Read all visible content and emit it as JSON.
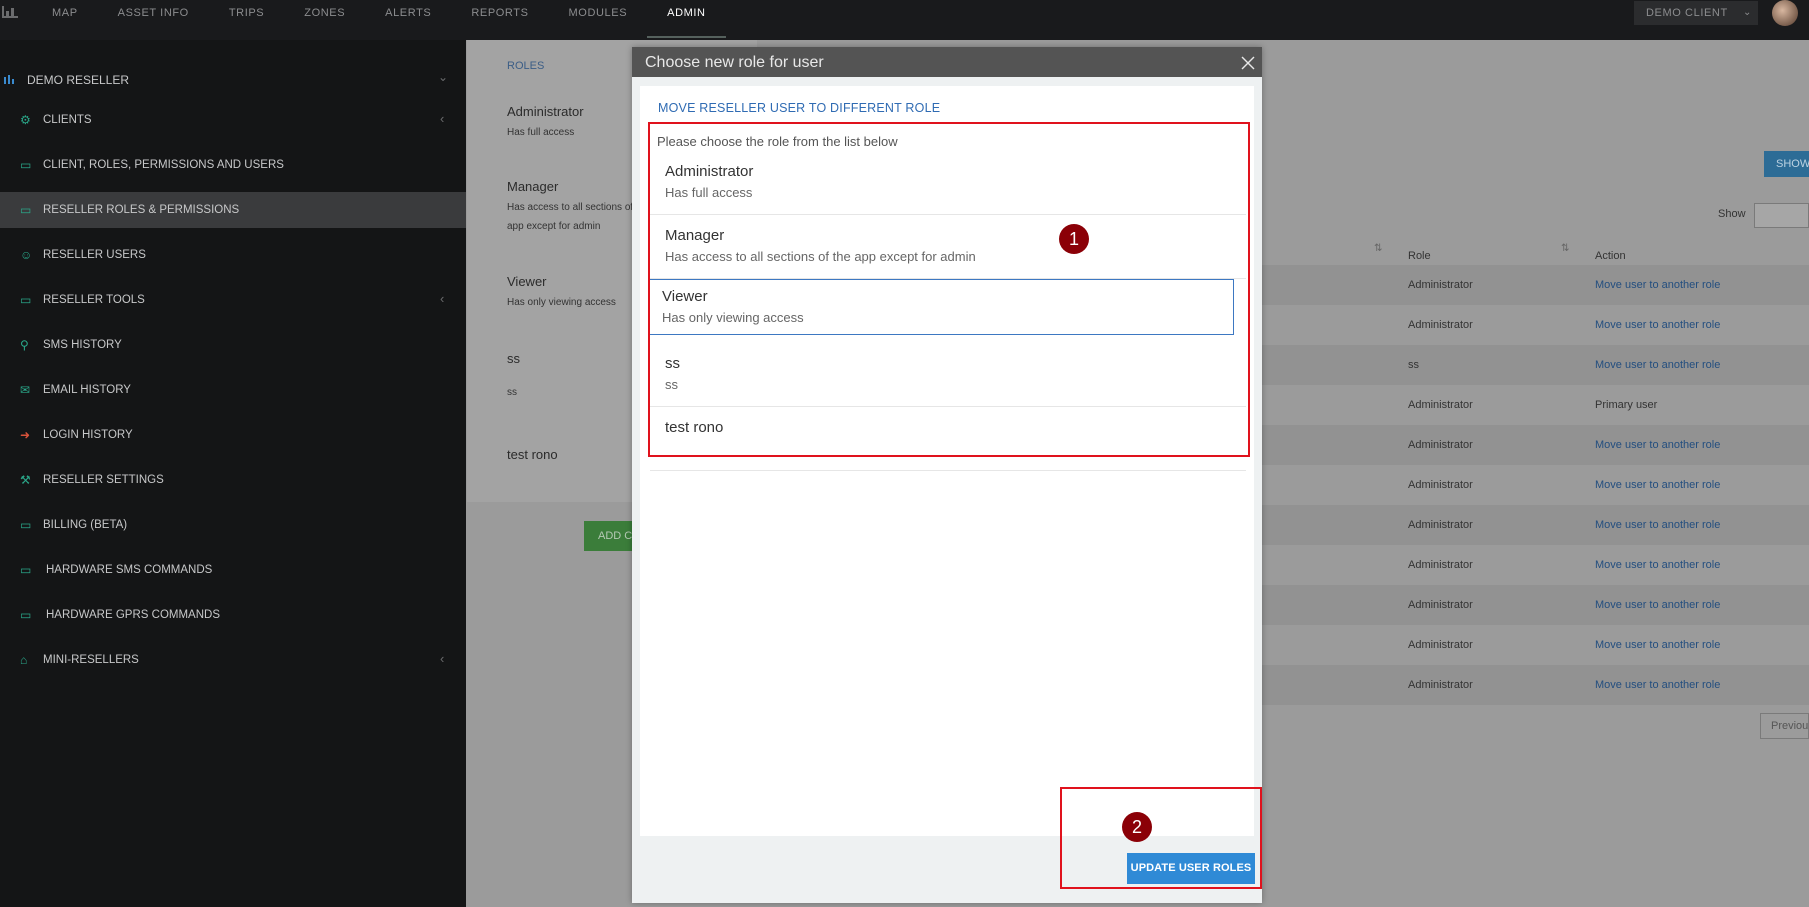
{
  "topbar": {
    "nav": [
      "MAP",
      "ASSET INFO",
      "TRIPS",
      "ZONES",
      "ALERTS",
      "REPORTS",
      "MODULES",
      "ADMIN"
    ],
    "active_nav": "ADMIN",
    "client_select": "DEMO CLIENT",
    "icons": [
      "bar-chart-logo-icon",
      "chevron-down-icon",
      "user-avatar"
    ]
  },
  "sidebar": {
    "header": "DEMO RESELLER",
    "items": [
      {
        "label": "CLIENTS",
        "icon": "sitemap-icon",
        "has_caret": true
      },
      {
        "label": "CLIENT, ROLES, PERMISSIONS AND USERS",
        "icon": "card-icon",
        "has_caret": false
      },
      {
        "label": "RESELLER ROLES & PERMISSIONS",
        "icon": "card-icon",
        "has_caret": false,
        "active": true
      },
      {
        "label": "RESELLER USERS",
        "icon": "user-icon",
        "has_caret": false
      },
      {
        "label": "RESELLER TOOLS",
        "icon": "folder-icon",
        "has_caret": true
      },
      {
        "label": "SMS HISTORY",
        "icon": "search-icon",
        "has_caret": false
      },
      {
        "label": "EMAIL HISTORY",
        "icon": "envelope-icon",
        "has_caret": false
      },
      {
        "label": "LOGIN HISTORY",
        "icon": "sign-in-icon",
        "has_caret": false
      },
      {
        "label": "RESELLER SETTINGS",
        "icon": "wrench-icon",
        "has_caret": false
      },
      {
        "label": "BILLING (BETA)",
        "icon": "card-icon",
        "has_caret": false
      },
      {
        "label": "HARDWARE SMS COMMANDS",
        "icon": "card-icon",
        "has_caret": false
      },
      {
        "label": "HARDWARE GPRS COMMANDS",
        "icon": "card-icon",
        "has_caret": false
      },
      {
        "label": "MINI-RESELLERS",
        "icon": "home-icon",
        "has_caret": true
      }
    ]
  },
  "background": {
    "roles_title": "ROLES",
    "roles": [
      {
        "name": "Administrator",
        "desc": "Has full access"
      },
      {
        "name": "Manager",
        "desc": "Has access to all sections of the app except for admin"
      },
      {
        "name": "Viewer",
        "desc": "Has only viewing access"
      },
      {
        "name": "ss",
        "desc": "ss"
      },
      {
        "name": "test rono",
        "desc": ""
      }
    ],
    "add_button": "ADD C",
    "show_button": "SHOW",
    "show_label": "Show",
    "columns": {
      "role": "Role",
      "action": "Action"
    },
    "rows": [
      {
        "role": "Administrator",
        "action": "Move user to another role"
      },
      {
        "role": "Administrator",
        "action": "Move user to another role"
      },
      {
        "role": "ss",
        "action": "Move user to another role"
      },
      {
        "role": "Administrator",
        "action": "Primary user"
      },
      {
        "role": "Administrator",
        "action": "Move user to another role"
      },
      {
        "role": "Administrator",
        "action": "Move user to another role"
      },
      {
        "role": "Administrator",
        "action": "Move user to another role"
      },
      {
        "role": "Administrator",
        "action": "Move user to another role"
      },
      {
        "role": "Administrator",
        "action": "Move user to another role"
      },
      {
        "role": "Administrator",
        "action": "Move user to another role"
      },
      {
        "role": "Administrator",
        "action": "Move user to another role"
      }
    ],
    "prev_button": "Previou"
  },
  "modal": {
    "title": "Choose new role for user",
    "section_title": "MOVE RESELLER USER TO DIFFERENT ROLE",
    "instructions": "Please choose the role from the list below",
    "roles": [
      {
        "name": "Administrator",
        "desc": "Has full access"
      },
      {
        "name": "Manager",
        "desc": "Has access to all sections of the app except for admin"
      },
      {
        "name": "Viewer",
        "desc": "Has only viewing access",
        "selected": true
      },
      {
        "name": "ss",
        "desc": "ss"
      },
      {
        "name": "test rono",
        "desc": ""
      }
    ],
    "update_button": "UPDATE USER ROLES"
  },
  "annotations": [
    "1",
    "2"
  ],
  "colors": {
    "accent_blue": "#2f8ad6",
    "link_blue": "#2f6bb3",
    "annotation_red": "#e0121d",
    "badge_dark_red": "#8b0007",
    "sidebar_icon_teal": "#2aa88a"
  }
}
